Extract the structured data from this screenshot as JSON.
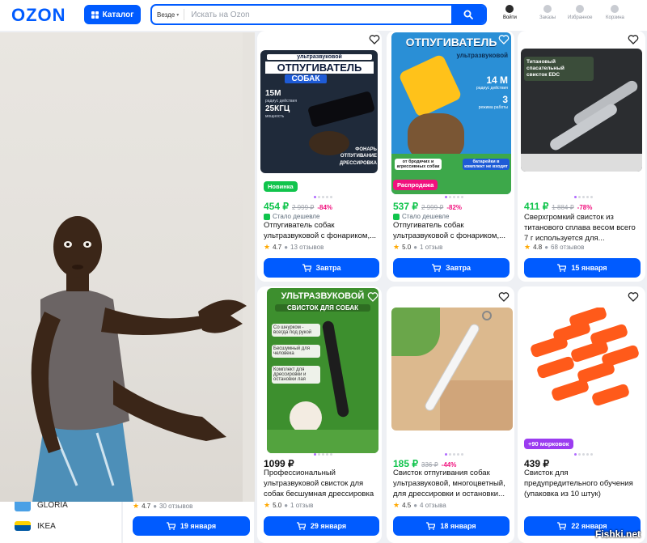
{
  "header": {
    "logo": "OZON",
    "catalog_label": "Каталог",
    "search_scope": "Везде",
    "search_placeholder": "Искать на Ozon",
    "nav": [
      {
        "label": "Войти",
        "icon": "user-icon"
      },
      {
        "label": "Заказы",
        "icon": "box-icon"
      },
      {
        "label": "Избранное",
        "icon": "heart-icon"
      },
      {
        "label": "Корзина",
        "icon": "cart-icon"
      }
    ]
  },
  "sidebar": {
    "brands": [
      {
        "name": "GLORIA",
        "color": "#4aa0e6"
      },
      {
        "name": "IKEA",
        "color": "#0058a3"
      }
    ]
  },
  "products": [
    {
      "image_text": [
        "ультразвуковой",
        "ОТПУГИВАТЕЛЬ",
        "СОБАК",
        "15М",
        "радиус действия",
        "25КГЦ",
        "мощность",
        "ФОНАРЬ",
        "ОТПУГИВАНИЕ",
        "ДРЕССИРОВКА"
      ],
      "badge": "Новинка",
      "badge_color": "#10c44c",
      "price": "454 ₽",
      "old_price": "2 999 ₽",
      "discount": "-84%",
      "note": "Стало дешевле",
      "title": "Отпугиватель собак ультразвуковой с фонариком,...",
      "rating": "4.7",
      "reviews": "13 отзывов",
      "delivery": "Завтра"
    },
    {
      "image_text": [
        "ОТПУГИВАТЕЛЬ",
        "ультразвуковой",
        "14 М",
        "радиус действия",
        "3",
        "режима работы",
        "от бродячих и агрессивных собак",
        "батарейки в комплект не входят"
      ],
      "badge": "Распродажа",
      "badge_color": "#f1117e",
      "price": "537 ₽",
      "old_price": "2 999 ₽",
      "discount": "-82%",
      "note": "Стало дешевле",
      "title": "Отпугиватель собак ультразвуковой с фонариком,...",
      "rating": "5.0",
      "reviews": "1 отзыв",
      "delivery": "Завтра"
    },
    {
      "image_text": [
        "Титановый",
        "спасательный",
        "свисток EDC"
      ],
      "price": "411 ₽",
      "old_price": "1 884 ₽",
      "discount": "-78%",
      "title": "Сверхгромкий свисток из титанового сплава весом всего 7 г используется для...",
      "rating": "4.8",
      "reviews": "68 отзывов",
      "delivery": "15 января"
    },
    {
      "image_text": [
        "УЛЬТРАЗВУКОВОЙ",
        "СВИСТОК ДЛЯ СОБАК",
        "Со шнурком - всегда под рукой",
        "Бесшумный для человека",
        "Комплект для дрессировки и остановки лая"
      ],
      "price": "1099 ₽",
      "title": "Профессиональный ультразвуковой свисток для собак бесшумная дрессировка ...",
      "rating": "5.0",
      "reviews": "1 отзыв",
      "delivery": "29 января"
    },
    {
      "price": "185 ₽",
      "old_price": "336 ₽",
      "discount": "-44%",
      "title": "Свисток отпугивания собак ультразвуковой, многоцветный, для дрессировки и остановки...",
      "rating": "4.5",
      "reviews": "4 отзыва",
      "delivery": "18 января"
    },
    {
      "badge": "+90 морковок",
      "badge_color": "#9b3cf0",
      "price": "439 ₽",
      "title": "Свисток для предупредительного обучения (упаковка из 10 штук)",
      "delivery": "22 января"
    }
  ],
  "hidden_card": {
    "rating": "4.7",
    "reviews": "30 отзывов",
    "delivery": "19 января"
  },
  "watermark": "Fishki.net"
}
